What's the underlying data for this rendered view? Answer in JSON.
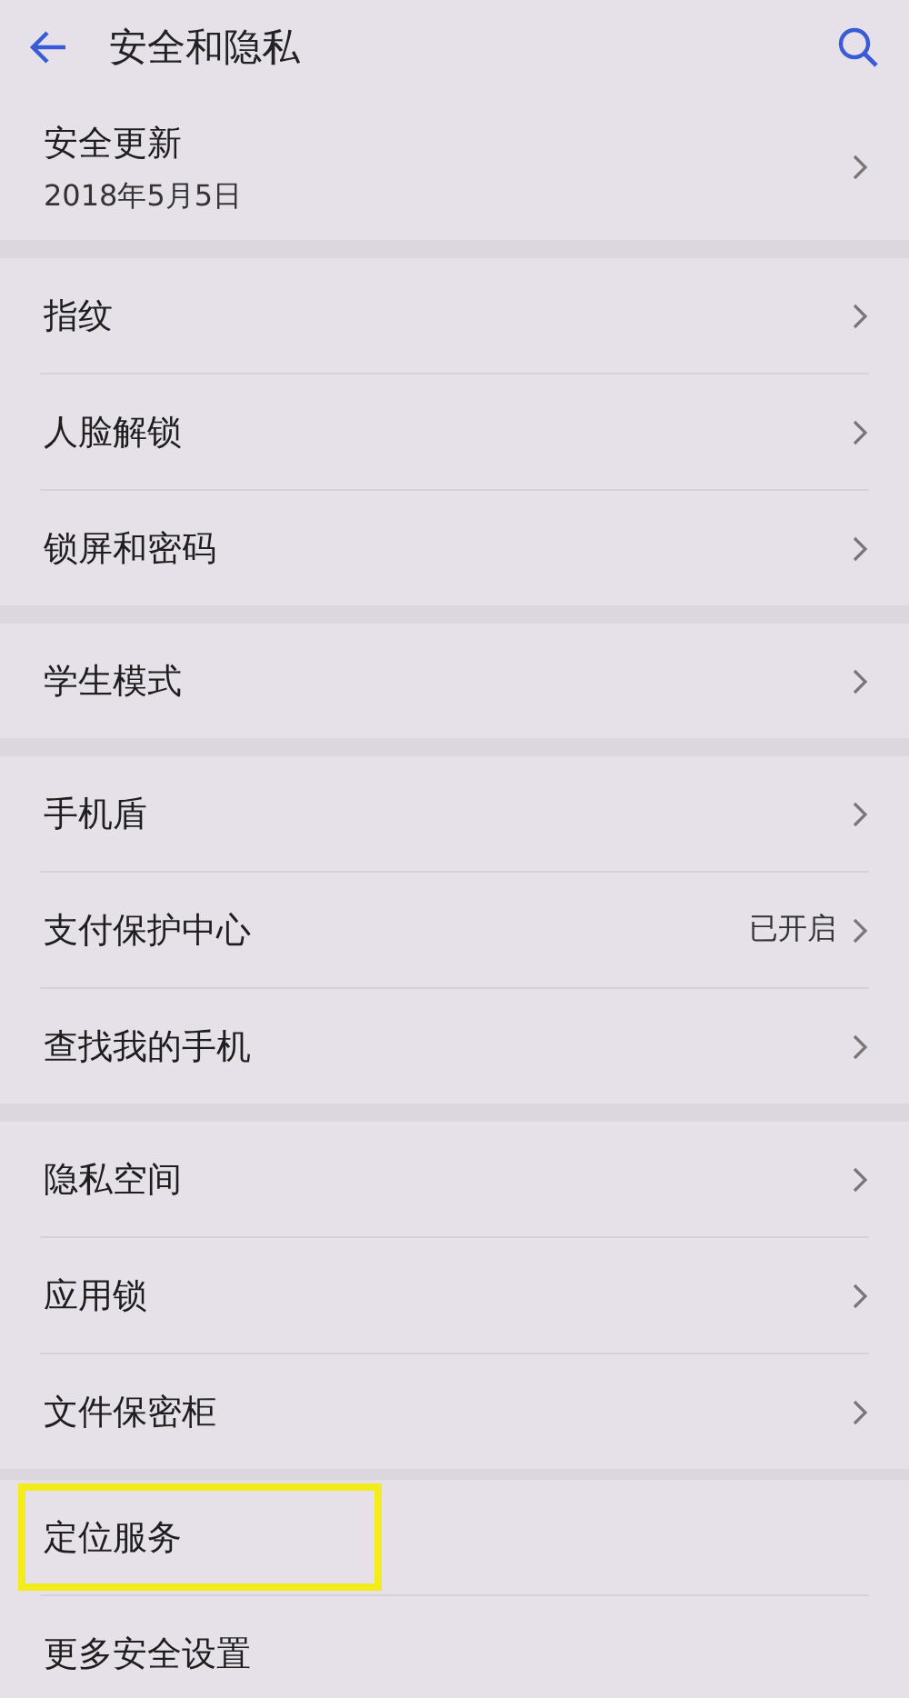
{
  "header": {
    "title": "安全和隐私"
  },
  "groups": [
    {
      "items": [
        {
          "label": "安全更新",
          "subtitle": "2018年5月5日",
          "chevron": true,
          "highlighted": false
        }
      ]
    },
    {
      "items": [
        {
          "label": "指纹",
          "chevron": true,
          "highlighted": false
        },
        {
          "label": "人脸解锁",
          "chevron": true,
          "highlighted": false
        },
        {
          "label": "锁屏和密码",
          "chevron": true,
          "highlighted": false
        }
      ]
    },
    {
      "items": [
        {
          "label": "学生模式",
          "chevron": true,
          "highlighted": false
        }
      ]
    },
    {
      "items": [
        {
          "label": "手机盾",
          "chevron": true,
          "highlighted": false
        },
        {
          "label": "支付保护中心",
          "value": "已开启",
          "chevron": true,
          "highlighted": false
        },
        {
          "label": "查找我的手机",
          "chevron": true,
          "highlighted": false
        }
      ]
    },
    {
      "items": [
        {
          "label": "隐私空间",
          "chevron": true,
          "highlighted": false
        },
        {
          "label": "应用锁",
          "chevron": true,
          "highlighted": false
        },
        {
          "label": "文件保密柜",
          "chevron": true,
          "highlighted": false
        }
      ]
    },
    {
      "items": [
        {
          "label": "定位服务",
          "chevron": false,
          "highlighted": true
        },
        {
          "label": "更多安全设置",
          "chevron": false,
          "highlighted": false
        }
      ]
    }
  ]
}
